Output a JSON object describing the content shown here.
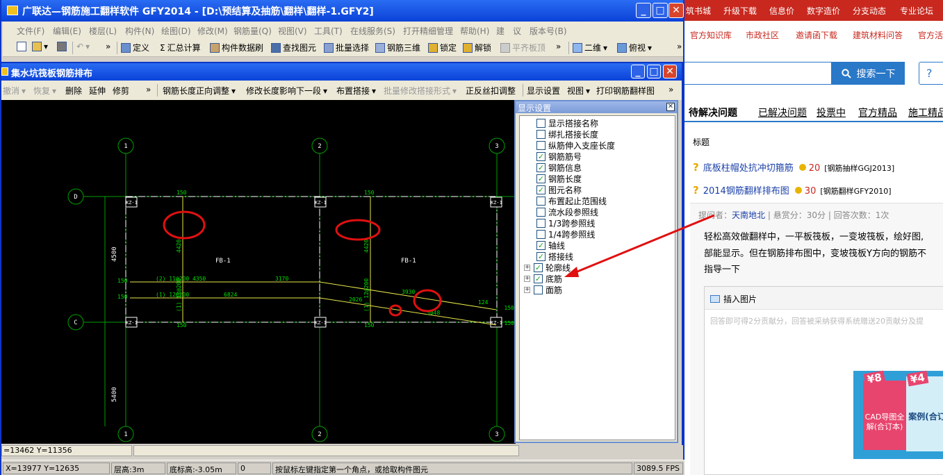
{
  "app_window": {
    "title": "广联达—钢筋施工翻样软件 GFY2014 - [D:\\预结算及抽筋\\翻样\\翻样-1.GFY2]",
    "menu": [
      "文件(F)",
      "编辑(E)",
      "楼层(L)",
      "构件(N)",
      "绘图(D)",
      "修改(M)",
      "钢筋量(Q)",
      "视图(V)",
      "工具(T)",
      "在线服务(S)",
      "打开精细管理",
      "帮助(H)",
      "建",
      "议",
      "版本号(B)"
    ],
    "toolbar": {
      "define": "定义",
      "sum": "汇总计算",
      "brush": "构件数据刷",
      "find": "查找图元",
      "batch": "批量选择",
      "rebar3d": "钢筋三维",
      "lock": "锁定",
      "unlock": "解锁",
      "flatten": "平齐板顶",
      "view2d": "二维",
      "topview": "俯视"
    }
  },
  "child_window": {
    "title": "集水坑筏板钢筋排布",
    "toolbar": {
      "undo": "撤消",
      "redo": "恢复",
      "delete": "删除",
      "extend": "延伸",
      "trim": "修剪",
      "adjust_dir": "钢筋长度正向调整",
      "modify_next": "修改长度影响下一段",
      "lap_layout": "布置搭接",
      "batch_lap": "批量修改搭接形式",
      "thread": "正反丝扣调整",
      "display_settings": "显示设置",
      "view": "视图",
      "print": "打印钢筋翻样图"
    },
    "coords": "=13462 Y=11356"
  },
  "drawing": {
    "axes_top": [
      "1",
      "2",
      "3"
    ],
    "axes_left": [
      "D",
      "C"
    ],
    "slab_label": "FB-1",
    "column_label": "KZ-1",
    "dim_4500": "4500",
    "dim_5400": "5400",
    "dim_150": "150",
    "dim_4420": "4420",
    "bar2_label": "(2) 11@200 4350",
    "bar2_len": "3170",
    "bar1_label": "(1) 12@200",
    "bar1_len": "6824",
    "vbar_label": "(1) 12@200",
    "vbar2_label": "(1) 12@200",
    "len_2026": "2026",
    "len_3930": "3930",
    "len_5048": "5048",
    "len_124": "124"
  },
  "display_panel": {
    "title": "显示设置",
    "items": [
      {
        "label": "显示搭接名称",
        "checked": false,
        "expand": false
      },
      {
        "label": "绑扎搭接长度",
        "checked": false,
        "expand": false
      },
      {
        "label": "纵筋伸入支座长度",
        "checked": false,
        "expand": false
      },
      {
        "label": "钢筋筋号",
        "checked": true,
        "expand": false
      },
      {
        "label": "钢筋信息",
        "checked": true,
        "expand": false
      },
      {
        "label": "钢筋长度",
        "checked": true,
        "expand": false
      },
      {
        "label": "图元名称",
        "checked": true,
        "expand": false
      },
      {
        "label": "布置起止范围线",
        "checked": false,
        "expand": false
      },
      {
        "label": "流水段参照线",
        "checked": false,
        "expand": false
      },
      {
        "label": "1/3跨参照线",
        "checked": false,
        "expand": false
      },
      {
        "label": "1/4跨参照线",
        "checked": false,
        "expand": false
      },
      {
        "label": "轴线",
        "checked": true,
        "expand": false
      },
      {
        "label": "搭接线",
        "checked": true,
        "expand": false
      },
      {
        "label": "轮廓线",
        "checked": true,
        "expand": true
      },
      {
        "label": "底筋",
        "checked": true,
        "expand": true
      },
      {
        "label": "面筋",
        "checked": false,
        "expand": true
      }
    ]
  },
  "status_bar": {
    "coords": "X=13977 Y=12635",
    "floor_height": "层高:3m",
    "bottom_elev": "底标高:-3.05m",
    "value": "0",
    "prompt": "按鼠标左键指定第一个角点，或拾取构件图元",
    "fps": "3089.5 FPS"
  },
  "web": {
    "topnav": [
      "筑书城",
      "升级下载",
      "信息价",
      "数字造价",
      "分支动态",
      "专业论坛"
    ],
    "subnav": [
      "官方知识库",
      "市政社区",
      "邀请函下载",
      "建筑材料问答",
      "官方活"
    ],
    "search_button": "搜索一下",
    "help_button": "?",
    "tabs": [
      "待解决问题",
      "已解决问题",
      "投票中",
      "官方精品",
      "施工精品"
    ],
    "column_header": "标题",
    "questions": [
      {
        "title": "底板柱帽处抗冲切箍筋",
        "reward": "20",
        "tag": "[钢筋抽样GGJ2013]"
      },
      {
        "title": "2014钢筋翻样排布图",
        "reward": "30",
        "tag": "[钢筋翻样GFY2010]"
      }
    ],
    "meta": {
      "asker_label": "提问者：",
      "asker": "天南地北",
      "bounty": "悬赏分：30分",
      "answers": "回答次数：1次"
    },
    "body_lines": [
      "轻松高效做翻样中，一平板筏板，一变坡筏板，绘好图,",
      "部能显示。但在钢筋排布图中，变坡筏板Y方向的钢筋不",
      "指导一下"
    ],
    "insert_image": "插入图片",
    "answer_hint": "回答即可得2分贡献分，回答被采纳获得系统赠送20贡献分及提",
    "promo": {
      "badge1": "¥8",
      "badge2": "¥4",
      "book1": "CAD导图全解(合订本)",
      "book2": "案例(合订"
    }
  }
}
